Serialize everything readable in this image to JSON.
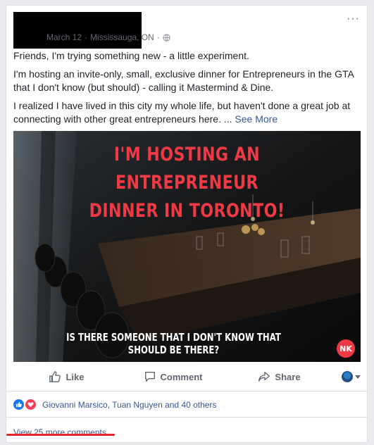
{
  "post": {
    "date": "March 12",
    "location": "Mississauga, ON",
    "separator": "·",
    "dot_separator": "·",
    "more_menu": "···",
    "paragraphs": [
      "Friends, I'm trying something new - a little experiment.",
      "I'm hosting an invite-only, small, exclusive dinner for Entrepreneurs in the GTA that I don't know (but should) - calling it Mastermind & Dine.",
      "I realized I have lived in this city my whole life, but haven't done a great job at connecting with other great entrepreneurs here. ..."
    ],
    "see_more": "See More"
  },
  "image": {
    "headline_line1": "I'M HOSTING AN ENTREPRENEUR",
    "headline_line2": "DINNER IN TORONTO!",
    "caption": "IS THERE SOMEONE THAT I DON'T KNOW THAT SHOULD BE THERE?",
    "logo_text": "NK",
    "headline_color": "#ef3a46"
  },
  "actions": {
    "like": "Like",
    "comment": "Comment",
    "share": "Share"
  },
  "reactions": {
    "names": "Giovanni Marsico, Tuan Nguyen and 40 others",
    "like_color": "#1877f2",
    "love_color": "#f33e58"
  },
  "comments": {
    "view_more": "View 25 more comments"
  },
  "colors": {
    "link": "#365899",
    "meta": "#616770",
    "underline": "#e0242c"
  }
}
